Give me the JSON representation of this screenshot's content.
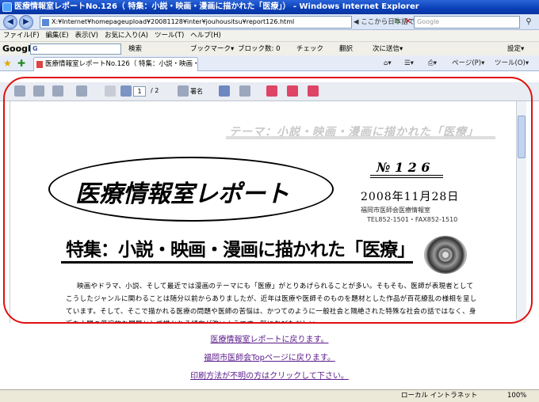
{
  "window": {
    "title": "医療情報室レポートNo.126（ 特集：小説・映画・漫画に描かれた「医療」） - Windows Internet Explorer"
  },
  "address": {
    "url": "X:¥Internet¥homepageupload¥20081128¥inter¥jouhousitsu¥report126.html",
    "search_hint": "ここから日本語で検索(J¥ord)",
    "search_placeholder": "Google"
  },
  "menu": [
    "ファイル(F)",
    "編集(E)",
    "表示(V)",
    "お気に入り(A)",
    "ツール(T)",
    "ヘルプ(H)"
  ],
  "google_toolbar": {
    "logo": "Google",
    "input": "G",
    "items": [
      "検索",
      "ブックマーク▾",
      "ブロック数: 0",
      "チェック",
      "翻訳",
      "次に送信▾",
      "設定▾"
    ]
  },
  "tab": {
    "label": "医療情報室レポートNo.126（ 特集：小説・映画・漫画に..."
  },
  "right_tools": {
    "page": "ページ(P)▾",
    "tools": "ツール(O)▾"
  },
  "pdf_toolbar": {
    "page_current": "1",
    "page_total": "/ 2",
    "sign_label": "署名"
  },
  "document": {
    "theme": "テーマ：小説・映画・漫画に描かれた「医療」",
    "issue": "№ 1 2 6",
    "main_title": "医療情報室レポート",
    "date": "2008年11月28日",
    "association": "福岡市医師会医療情報室",
    "tel": "TEL852-1501・FAX852-1510",
    "feature_title": "特集：小説・映画・漫画に描かれた「医療」",
    "body": "映画やドラマ、小説、そして最近では漫画のテーマにも「医療」がとりあげられることが多い。そもそも、医師が表現者としてこうしたジャンルに関わることは随分以前からありましたが、近年は医療や医師そのものを題材とした作品が百花繚乱の様相を呈しています。そして、そこで描かれる医療の問題や医師の苦悩は、かつてのように一般社会と隔絶された特殊な社会の話ではなく、身近な人間の普遍的な問題として描かれる傾向が強いようです。既におびただしい"
  },
  "links": [
    "医療情報室レポートに戻ります。",
    "福岡市医師会Topページに戻ります。",
    "印刷方法が不明の方はクリックして下さい。"
  ],
  "status": {
    "zone": "ローカル イントラネット",
    "zoom": "100%"
  }
}
